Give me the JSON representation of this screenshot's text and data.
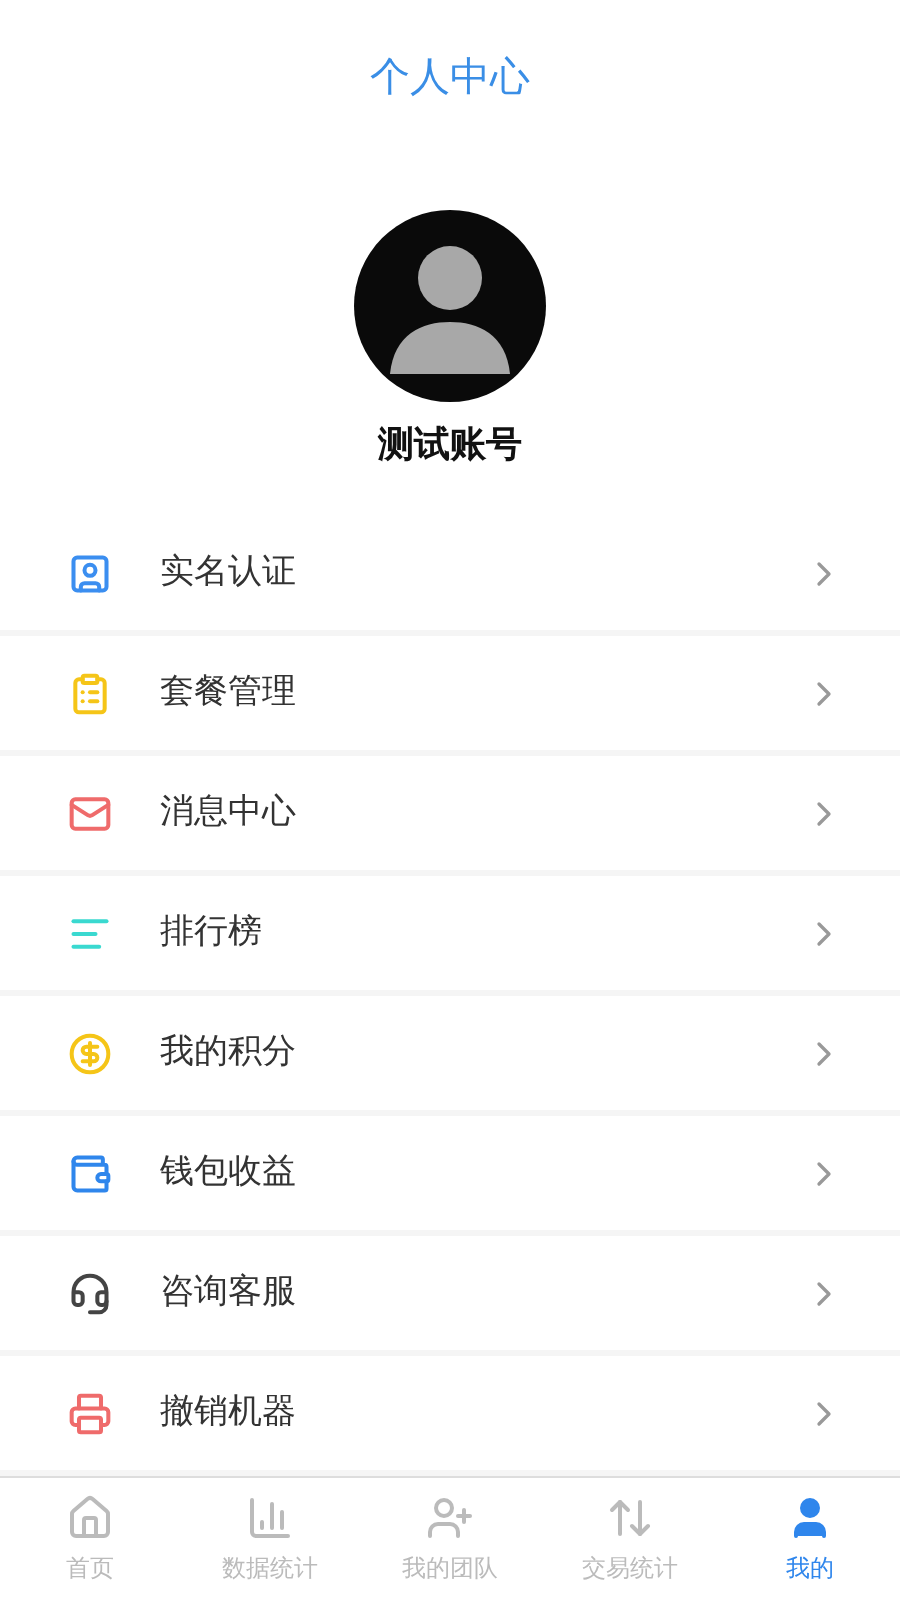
{
  "header": {
    "title": "个人中心"
  },
  "profile": {
    "name": "测试账号"
  },
  "menu": [
    {
      "label": "实名认证",
      "kind": "id",
      "color": "#3b8ef0"
    },
    {
      "label": "套餐管理",
      "kind": "clipboard",
      "color": "#f5c518"
    },
    {
      "label": "消息中心",
      "kind": "mail",
      "color": "#ef6b6b"
    },
    {
      "label": "排行榜",
      "kind": "rank",
      "color": "#3ad9d0"
    },
    {
      "label": "我的积分",
      "kind": "coin",
      "color": "#f5c518"
    },
    {
      "label": "钱包收益",
      "kind": "wallet",
      "color": "#2f86ec"
    },
    {
      "label": "咨询客服",
      "kind": "service",
      "color": "#444444"
    },
    {
      "label": "撤销机器",
      "kind": "machine",
      "color": "#ef6b6b"
    }
  ],
  "tabbar": [
    {
      "label": "首页",
      "kind": "home",
      "selected": false
    },
    {
      "label": "数据统计",
      "kind": "stats",
      "selected": false
    },
    {
      "label": "我的团队",
      "kind": "team",
      "selected": false
    },
    {
      "label": "交易统计",
      "kind": "trade",
      "selected": false
    },
    {
      "label": "我的",
      "kind": "me",
      "selected": true
    }
  ]
}
